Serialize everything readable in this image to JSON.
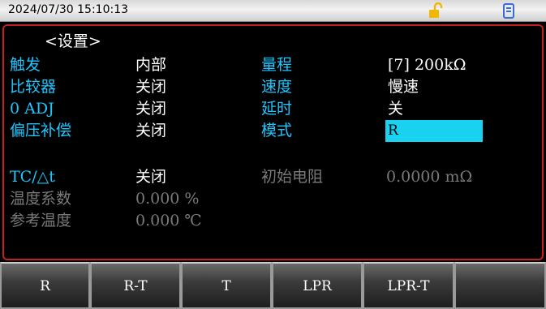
{
  "status_bar": {
    "datetime": "2024/07/30 15:10:13",
    "lock_icon": "unlock-icon",
    "lock_color": "#f0b800",
    "usb_icon": "usb-icon",
    "usb_color": "#3a6cd8"
  },
  "settings": {
    "title": "<设置>",
    "trigger_label": "触发",
    "trigger_value": "内部",
    "range_label": "量程",
    "range_value": "[7] 200kΩ",
    "comparator_label": "比较器",
    "comparator_value": "关闭",
    "speed_label": "速度",
    "speed_value": "慢速",
    "zero_adj_label": "0 ADJ",
    "zero_adj_value": "关闭",
    "delay_label": "延时",
    "delay_value": "关",
    "bias_comp_label": "偏压补偿",
    "bias_comp_value": "关闭",
    "mode_label": "模式",
    "mode_value": "R",
    "tc_label": "TC/△t",
    "tc_value": "关闭",
    "init_res_label": "初始电阻",
    "init_res_value": "0.0000 mΩ",
    "temp_coef_label": "温度系数",
    "temp_coef_value": "0.000 %",
    "ref_temp_label": "参考温度",
    "ref_temp_value": "0.000 ℃"
  },
  "softkeys": [
    "R",
    "R-T",
    "T",
    "LPR",
    "LPR-T",
    ""
  ],
  "colors": {
    "label": "#1ec6ff",
    "value": "#ffffff",
    "disabled": "#7a7a7a",
    "highlight": "#18d2f0",
    "frame": "#c02020"
  }
}
